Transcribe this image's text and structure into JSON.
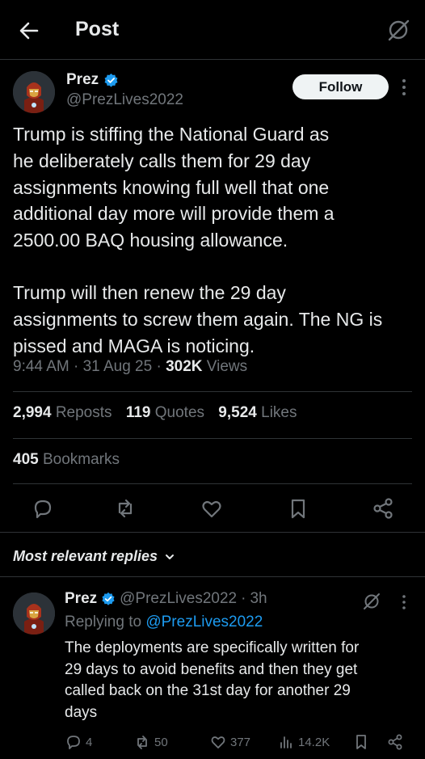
{
  "header": {
    "title": "Post",
    "back_icon": "arrow-left-icon",
    "grok_icon": "grok-icon"
  },
  "post": {
    "author_name": "Prez",
    "author_handle": "@PrezLives2022",
    "follow_label": "Follow",
    "text_p1_lines": [
      "Trump is stiffing the National Guard as",
      "he deliberately calls them for 29 day",
      "assignments knowing full well that one",
      "additional day more will provide them a",
      "2500.00 BAQ housing allowance."
    ],
    "text_p2_lines": [
      "Trump will then renew the 29 day",
      "assignments to screw them again. The NG is",
      "pissed and MAGA is noticing."
    ],
    "time": "9:44 AM",
    "date": "31 Aug 25",
    "views_count": "302K",
    "views_label": "Views",
    "reposts_count": "2,994",
    "reposts_label": "Reposts",
    "quotes_count": "119",
    "quotes_label": "Quotes",
    "likes_count": "9,524",
    "likes_label": "Likes",
    "bookmarks_count": "405",
    "bookmarks_label": "Bookmarks"
  },
  "replies_section": {
    "label": "Most relevant replies"
  },
  "reply": {
    "author_name": "Prez",
    "author_handle": "@PrezLives2022",
    "age": "3h",
    "replying_prefix": "Replying to",
    "replying_handle": "@PrezLives2022",
    "text_lines": [
      "The deployments are specifically written for",
      "29 days to avoid benefits and then they get",
      "called back on the 31st day for another 29",
      "days"
    ],
    "replies_count": "4",
    "reposts_count": "50",
    "likes_count": "377",
    "views_count": "14.2K"
  },
  "colors": {
    "background": "#000000",
    "text": "#e7e9ea",
    "muted": "#71767b",
    "accent": "#1d9bf0",
    "divider": "#2f3336"
  }
}
